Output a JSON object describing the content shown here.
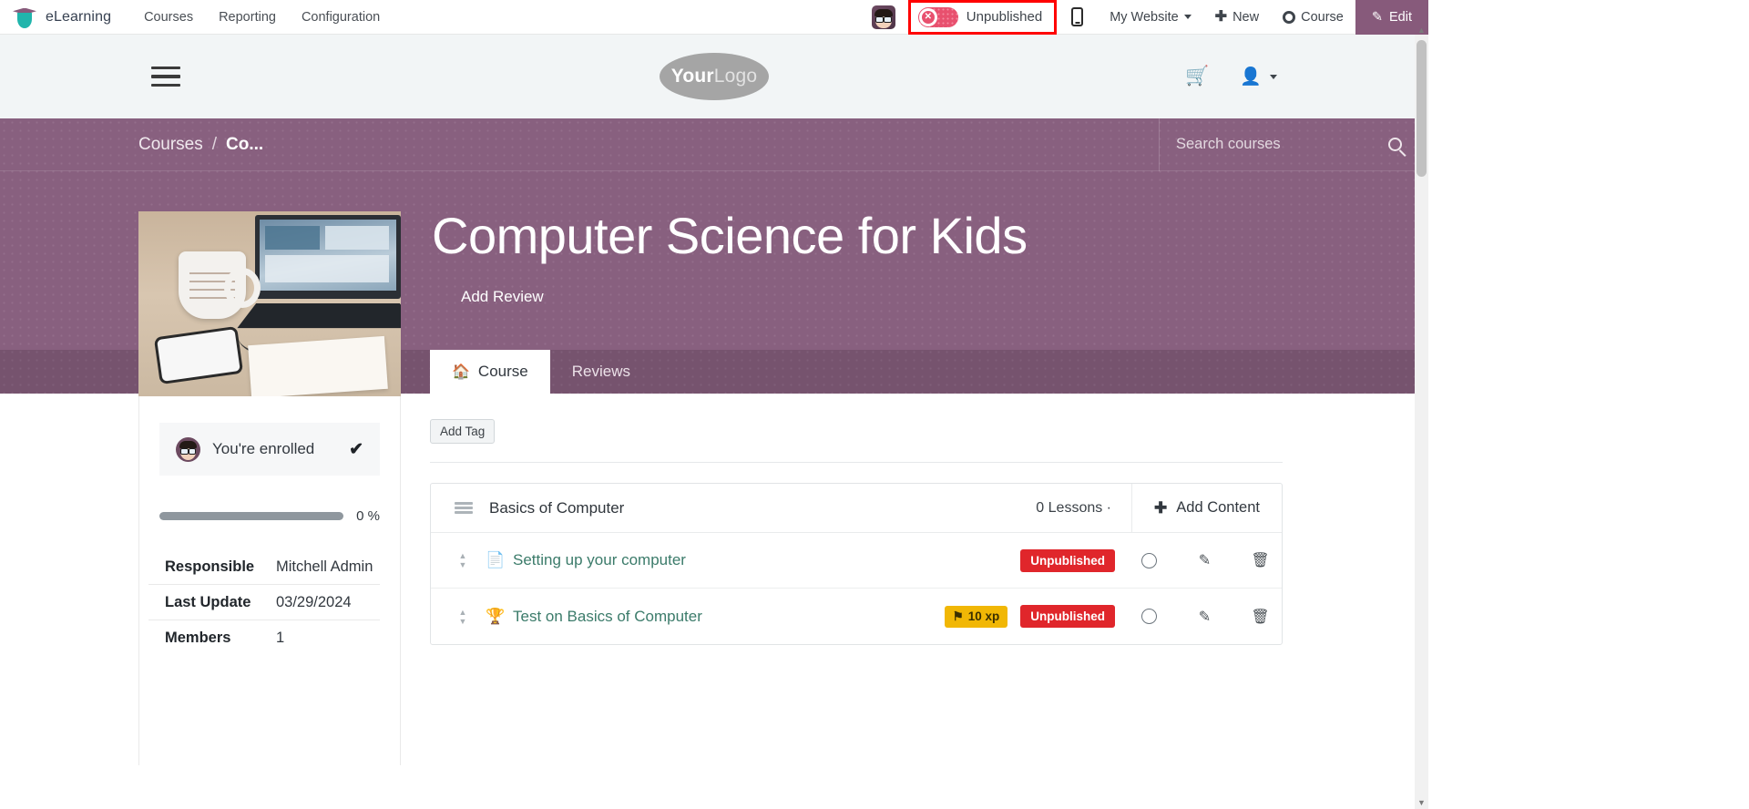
{
  "backend_bar": {
    "brand": "eLearning",
    "nav": [
      {
        "label": "Courses"
      },
      {
        "label": "Reporting"
      },
      {
        "label": "Configuration"
      }
    ],
    "avatar_name": "user-avatar",
    "publish_toggle": {
      "label": "Unpublished",
      "state": "off",
      "highlight_color": "#ff0000",
      "pill_color": "#e8506e",
      "icon": "x-circle-icon"
    },
    "mobile_preview_icon": "mobile-icon",
    "my_website": "My Website",
    "new_button": "New",
    "course_button": "Course",
    "edit_button": "Edit",
    "edit_button_color": "#875a7b"
  },
  "site_header": {
    "menu_icon": "hamburger-icon",
    "logo_your": "Your",
    "logo_logo": "Logo",
    "cart_icon": "cart-icon",
    "user_icon": "user-icon"
  },
  "hero": {
    "breadcrumb": [
      {
        "label": "Courses",
        "current": false
      },
      {
        "label": "Co...",
        "current": true
      }
    ],
    "breadcrumb_separator": "/",
    "search": {
      "placeholder": "Search courses",
      "value": "",
      "icon": "search-icon"
    },
    "course_title": "Computer Science for Kids",
    "add_review": "Add Review",
    "background_color": "#88607f",
    "tabs": [
      {
        "label": "Course",
        "icon": "home-icon",
        "active": true
      },
      {
        "label": "Reviews",
        "icon": "",
        "active": false
      }
    ]
  },
  "sidebar": {
    "enrolled_text": "You're enrolled",
    "enrolled_check": "✔",
    "progress_percent": "0 %",
    "progress_value": 0,
    "info": [
      {
        "key": "Responsible",
        "value": "Mitchell Admin"
      },
      {
        "key": "Last Update",
        "value": "03/29/2024"
      },
      {
        "key": "Members",
        "value": "1"
      }
    ]
  },
  "content": {
    "add_tag_label": "Add Tag",
    "section": {
      "title": "Basics of Computer",
      "lesson_count": "0  Lessons ·",
      "add_content_label": "Add Content",
      "add_content_icon": "plus-icon",
      "drag_icon": "drag-handle-icon"
    },
    "lessons": [
      {
        "title": "Setting up your computer",
        "type_icon": "document-icon",
        "xp_badge": "",
        "status_badge": "Unpublished",
        "status_color": "#e0262b",
        "toggle_icon": "circle-icon",
        "edit_icon": "pencil-icon",
        "delete_icon": "trash-icon"
      },
      {
        "title": "Test on Basics of Computer",
        "type_icon": "trophy-icon",
        "xp_badge": "10 xp",
        "xp_badge_icon": "flag-icon",
        "xp_badge_color": "#f1b705",
        "status_badge": "Unpublished",
        "status_color": "#e0262b",
        "toggle_icon": "circle-icon",
        "edit_icon": "pencil-icon",
        "delete_icon": "trash-icon"
      }
    ]
  }
}
